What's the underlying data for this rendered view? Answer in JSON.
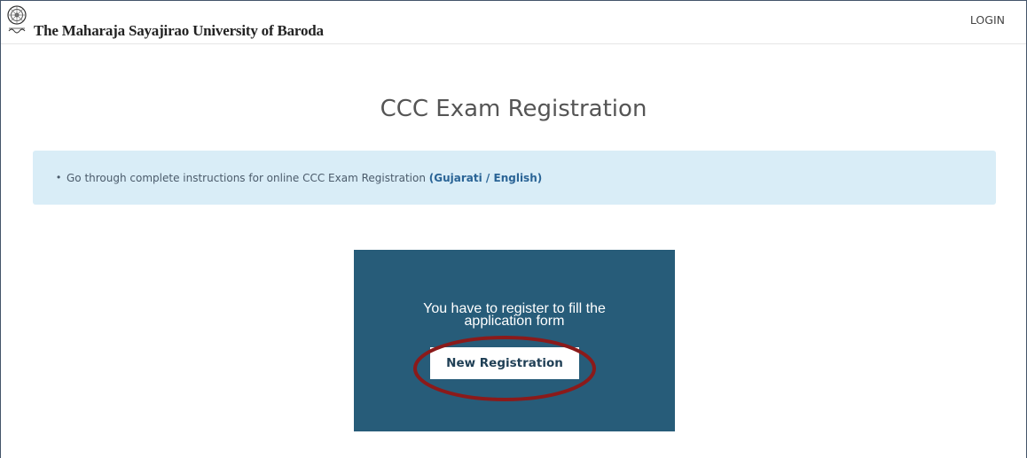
{
  "header": {
    "university_name": "The Maharaja Sayajirao University of Baroda",
    "login_label": "LOGIN"
  },
  "main": {
    "title": "CCC Exam Registration",
    "instructions": {
      "text": "Go through complete instructions for online CCC Exam Registration",
      "open_paren": "(",
      "gujarati_label": "Gujarati",
      "separator": " / ",
      "english_label": "English",
      "close_paren": ")"
    },
    "registration_card": {
      "message_line1": "You have to register to fill the",
      "message_line2": "application form",
      "button_label": "New Registration"
    }
  },
  "colors": {
    "card_bg": "#275c79",
    "alert_bg": "#d9edf7",
    "highlight_oval": "#8b1a1a",
    "link": "#2a6496"
  },
  "icons": {
    "logo": "university-emblem"
  }
}
